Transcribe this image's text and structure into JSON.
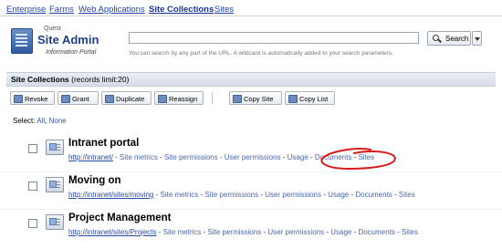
{
  "nav": {
    "items": [
      "Enterprise",
      "Farms",
      "Web Applications",
      "Site Collections",
      "Sites"
    ],
    "active_index": 3
  },
  "header": {
    "brand": "Quest",
    "title": "Site Admin",
    "subtitle": "Information Portal",
    "search": {
      "value": "",
      "hint": "You can search by any part of the URL. A wildcard is automatically added to your search parameters.",
      "button_label": "Search"
    }
  },
  "section": {
    "title": "Site Collections",
    "limit": "(records limit:20)"
  },
  "toolbar": {
    "buttons": [
      "Revoke",
      "Grant",
      "Duplicate",
      "Reassign",
      "Copy Site",
      "Copy List"
    ]
  },
  "select": {
    "label": "Select:",
    "all": "All",
    "separator": ",",
    "none": "None"
  },
  "sites": [
    {
      "name": "Intranet portal",
      "url": "http://intranet/",
      "links": [
        "Site metrics",
        "Site permissions",
        "User permissions",
        "Usage",
        "Documents",
        "Sites"
      ]
    },
    {
      "name": "Moving on",
      "url": "http://intranet/sites/moving",
      "links": [
        "Site metrics",
        "Site permissions",
        "User permissions",
        "Usage",
        "Documents",
        "Sites"
      ]
    },
    {
      "name": "Project Management",
      "url": "http://intranet/sites/Projects",
      "links": [
        "Site metrics",
        "Site permissions",
        "User permissions",
        "Usage",
        "Documents",
        "Sites"
      ]
    }
  ],
  "colors": {
    "link": "#3355aa",
    "annotation": "#d81a1a"
  }
}
